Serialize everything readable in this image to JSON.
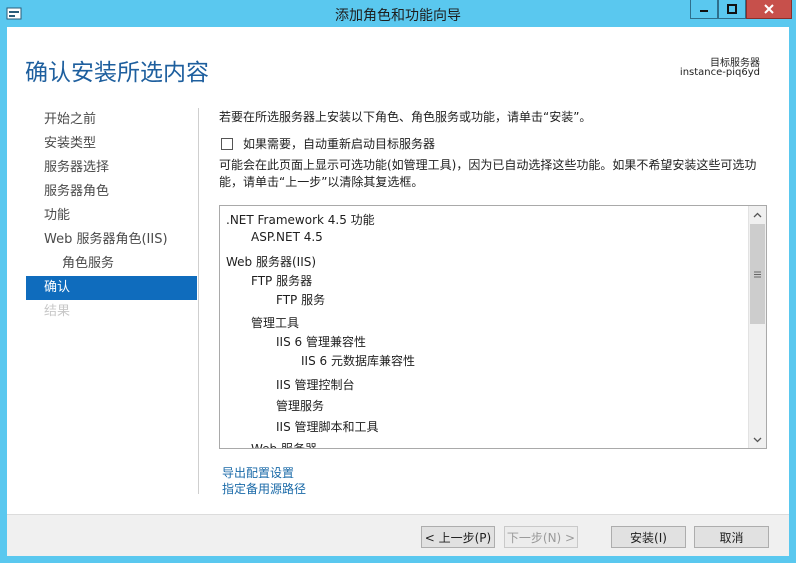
{
  "window": {
    "title": "添加角色和功能向导",
    "colors": {
      "titlebar": "#5ac8ef",
      "accent": "#0f6cbd",
      "close": "#c7504b",
      "heading": "#1e5f9e",
      "link": "#1a6aa8"
    }
  },
  "header": {
    "page_title": "确认安装所选内容",
    "target_label": "目标服务器",
    "target_name": "instance-piq6yd"
  },
  "nav": {
    "items": [
      {
        "label": "开始之前",
        "state": "normal"
      },
      {
        "label": "安装类型",
        "state": "normal"
      },
      {
        "label": "服务器选择",
        "state": "normal"
      },
      {
        "label": "服务器角色",
        "state": "normal"
      },
      {
        "label": "功能",
        "state": "normal"
      },
      {
        "label": "Web 服务器角色(IIS)",
        "state": "normal"
      },
      {
        "label": "角色服务",
        "state": "sub"
      },
      {
        "label": "确认",
        "state": "active"
      },
      {
        "label": "结果",
        "state": "disabled"
      }
    ]
  },
  "main": {
    "instruction": "若要在所选服务器上安装以下角色、角色服务或功能，请单击“安装”。",
    "restart_label": "如果需要，自动重新启动目标服务器",
    "restart_checked": false,
    "optional_note": "可能会在此页面上显示可选功能(如管理工具)，因为已自动选择这些功能。如果不希望安装这些可选功能，请单击“上一步”以清除其复选框。",
    "features": [
      ".NET Framework 4.5 功能",
      "ASP.NET 4.5",
      "Web 服务器(IIS)",
      "FTP 服务器",
      "FTP 服务",
      "管理工具",
      "IIS 6 管理兼容性",
      "IIS 6 元数据库兼容性",
      "IIS 管理控制台",
      "管理服务",
      "IIS 管理脚本和工具",
      "Web 服务器"
    ],
    "export_link": "导出配置设置",
    "alt_source_link": "指定备用源路径"
  },
  "footer": {
    "prev_label": "< 上一步(P)",
    "next_label": "下一步(N) >",
    "install_label": "安装(I)",
    "cancel_label": "取消"
  }
}
